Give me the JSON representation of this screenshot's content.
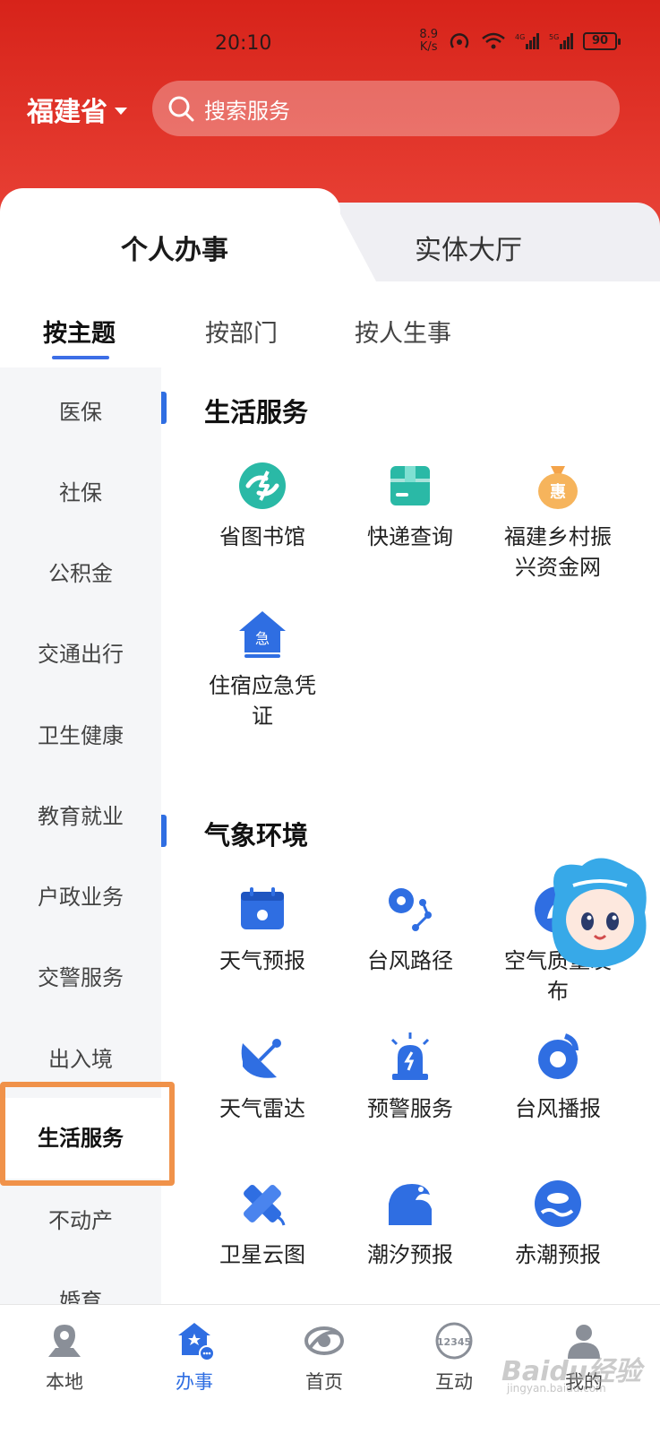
{
  "status_bar": {
    "time": "20:10",
    "net_speed_value": "8.9",
    "net_speed_unit": "K/s",
    "battery": "90"
  },
  "header": {
    "region": "福建省",
    "search_placeholder": "搜索服务"
  },
  "top_tabs": [
    {
      "label": "个人办事",
      "active": true
    },
    {
      "label": "实体大厅",
      "active": false
    }
  ],
  "sub_tabs": [
    {
      "label": "按主题",
      "active": true
    },
    {
      "label": "按部门",
      "active": false
    },
    {
      "label": "按人生事",
      "active": false
    }
  ],
  "sidebar": {
    "items": [
      {
        "label": "医保"
      },
      {
        "label": "社保"
      },
      {
        "label": "公积金"
      },
      {
        "label": "交通出行"
      },
      {
        "label": "卫生健康"
      },
      {
        "label": "教育就业"
      },
      {
        "label": "户政业务"
      },
      {
        "label": "交警服务"
      },
      {
        "label": "出入境"
      },
      {
        "label": "生活服务",
        "active": true
      },
      {
        "label": "不动产"
      },
      {
        "label": "婚育"
      }
    ]
  },
  "sections": [
    {
      "title": "生活服务",
      "items": [
        {
          "label_line1": "省图书馆",
          "label_line2": "",
          "icon": "library-icon",
          "color": "#2ab9a6"
        },
        {
          "label_line1": "快递查询",
          "label_line2": "",
          "icon": "parcel-box-icon",
          "color": "#2ab9a6"
        },
        {
          "label_line1": "福建乡村振",
          "label_line2": "兴资金网",
          "icon": "money-bag-icon",
          "color": "#f4a44a"
        },
        {
          "label_line1": "住宿应急凭",
          "label_line2": "证",
          "icon": "emergency-house-icon",
          "color": "#2f6ee2"
        }
      ]
    },
    {
      "title": "气象环境",
      "items": [
        {
          "label_line1": "天气预报",
          "label_line2": "",
          "icon": "calendar-sun-icon",
          "color": "#2f6ee2"
        },
        {
          "label_line1": "台风路径",
          "label_line2": "",
          "icon": "typhoon-path-icon",
          "color": "#2f6ee2"
        },
        {
          "label_line1": "空气质量发",
          "label_line2": "布",
          "icon": "leaf-circle-icon",
          "color": "#2f6ee2"
        },
        {
          "label_line1": "天气雷达",
          "label_line2": "",
          "icon": "radar-dish-icon",
          "color": "#2f6ee2"
        },
        {
          "label_line1": "预警服务",
          "label_line2": "",
          "icon": "alarm-light-icon",
          "color": "#2f6ee2"
        },
        {
          "label_line1": "台风播报",
          "label_line2": "",
          "icon": "typhoon-icon",
          "color": "#2f6ee2"
        },
        {
          "label_line1": "卫星云图",
          "label_line2": "",
          "icon": "satellite-icon",
          "color": "#2f6ee2"
        },
        {
          "label_line1": "潮汐预报",
          "label_line2": "",
          "icon": "wave-icon",
          "color": "#2f6ee2"
        },
        {
          "label_line1": "赤潮预报",
          "label_line2": "",
          "icon": "red-tide-icon",
          "color": "#2f6ee2"
        }
      ]
    }
  ],
  "bottom_nav": [
    {
      "label": "本地",
      "icon": "location-pin-icon",
      "active": false
    },
    {
      "label": "办事",
      "icon": "service-hall-icon",
      "active": true
    },
    {
      "label": "首页",
      "icon": "home-logo-icon",
      "active": false
    },
    {
      "label": "互动",
      "icon": "hotline-12345-icon",
      "active": false,
      "badge_text": "12345"
    },
    {
      "label": "我的",
      "icon": "user-profile-icon",
      "active": false
    }
  ],
  "watermark": {
    "text": "Baidu经验",
    "sub": "jingyan.baidu.com"
  },
  "colors": {
    "header_red": "#d7231a",
    "accent_blue": "#2f6ee2",
    "highlight_orange": "#f0924a"
  }
}
